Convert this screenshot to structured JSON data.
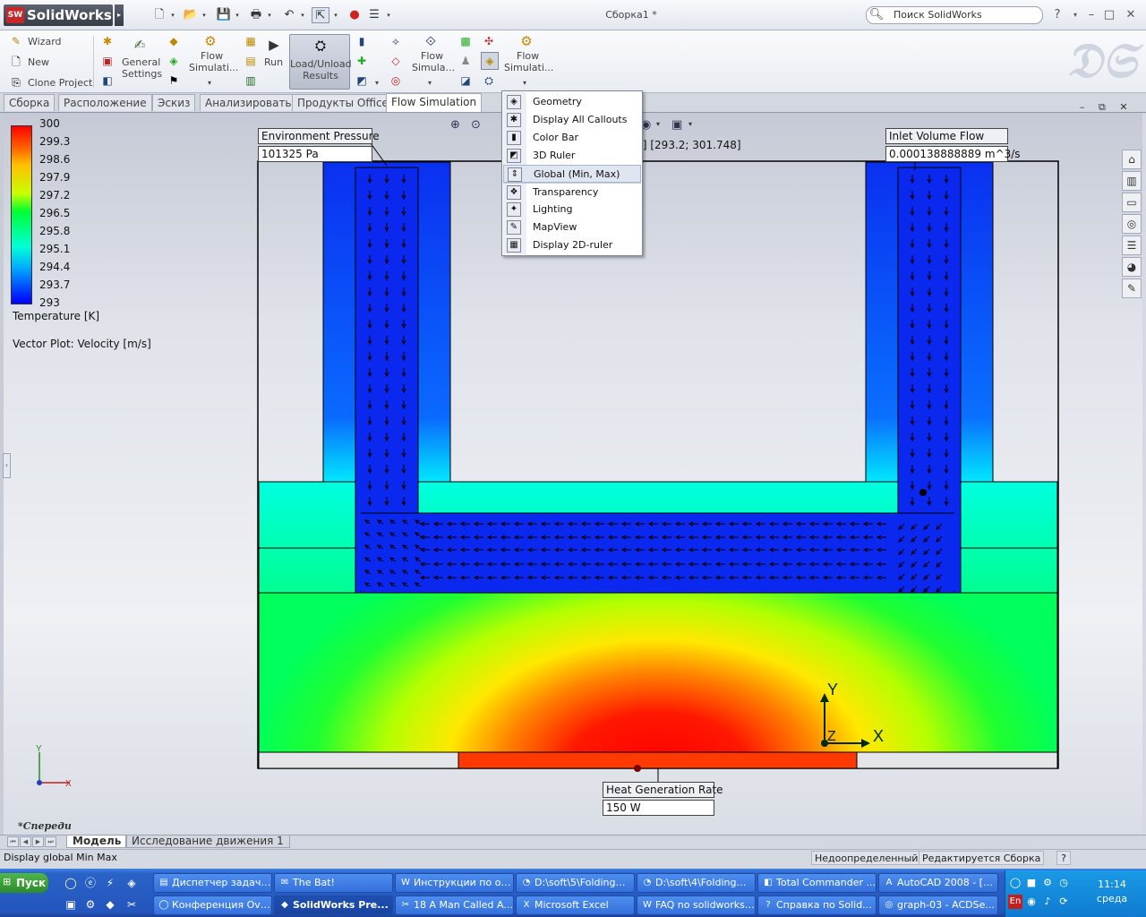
{
  "app": {
    "name": "SolidWorks",
    "badge": "SW",
    "window_title": "Сборка1 *",
    "search_placeholder": "Поиск SolidWorks",
    "help": "?",
    "menu_arrow": "▸"
  },
  "ribbon": {
    "wizard": "Wizard",
    "new": "New",
    "clone_project": "Clone Project",
    "general_settings_1": "General",
    "general_settings_2": "Settings",
    "flow_sim_1a": "Flow",
    "flow_sim_1b": "Simulati...",
    "run": "Run",
    "load_unload_1": "Load/Unload",
    "load_unload_2": "Results",
    "flow_sim_2a": "Flow",
    "flow_sim_2b": "Simula...",
    "flow_sim_3a": "Flow",
    "flow_sim_3b": "Simulati..."
  },
  "tabs": [
    "Сборка",
    "Расположение",
    "Эскиз",
    "Анализировать",
    "Продукты Office",
    "Flow Simulation"
  ],
  "legend": {
    "title": "Temperature [K]",
    "values": [
      "300",
      "299.3",
      "298.6",
      "297.9",
      "297.2",
      "296.5",
      "295.8",
      "295.1",
      "294.4",
      "293.7",
      "293"
    ],
    "vector_title": "Vector Plot: Velocity [m/s]",
    "range_text": "K] [293.2; 301.748]"
  },
  "colors": {
    "hot": "#ff0000",
    "cold": "#0000ff",
    "mid": "#00ff40",
    "channel": "#0a28ee"
  },
  "callouts": {
    "env_pressure_label": "Environment Pressure",
    "env_pressure_value": "101325 Pa",
    "inlet_flow_label": "Inlet Volume Flow",
    "inlet_flow_value": "0.000138888889 m^3/s",
    "heat_gen_label": "Heat Generation Rate",
    "heat_gen_value": "150 W"
  },
  "dropdown": [
    "Geometry",
    "Display All Callouts",
    "Color Bar",
    "3D Ruler",
    "Global (Min, Max)",
    "Transparency",
    "Lighting",
    "MapView",
    "Display 2D-ruler"
  ],
  "axes": {
    "x": "X",
    "y": "Y",
    "z": "Z"
  },
  "view_name": "*Спереди",
  "bottom_tabs": [
    "Модель",
    "Исследование движения 1"
  ],
  "status": {
    "hint": "Display global Min  Max",
    "state": "Недоопределенный",
    "edit": "Редактируется Сборка",
    "help": "?"
  },
  "taskbar": {
    "start": "Пуск",
    "row1": [
      "Диспетчер задач ...",
      "The Bat!",
      "Инструкции по об...",
      "D:\\soft\\5\\Folding@...",
      "D:\\soft\\4\\Folding@...",
      "Total Commander ...",
      "AutoCAD 2008 - [Ч..."
    ],
    "row2": [
      "Конференция Ove...",
      "SolidWorks Pre...",
      "18 A Man Called A...",
      "Microsoft Excel",
      "FAQ no solidworks ...",
      "Справка по Solid...",
      "graph-03 - ACDSe..."
    ],
    "clock_time": "11:14",
    "clock_day": "среда",
    "lang": "En"
  }
}
